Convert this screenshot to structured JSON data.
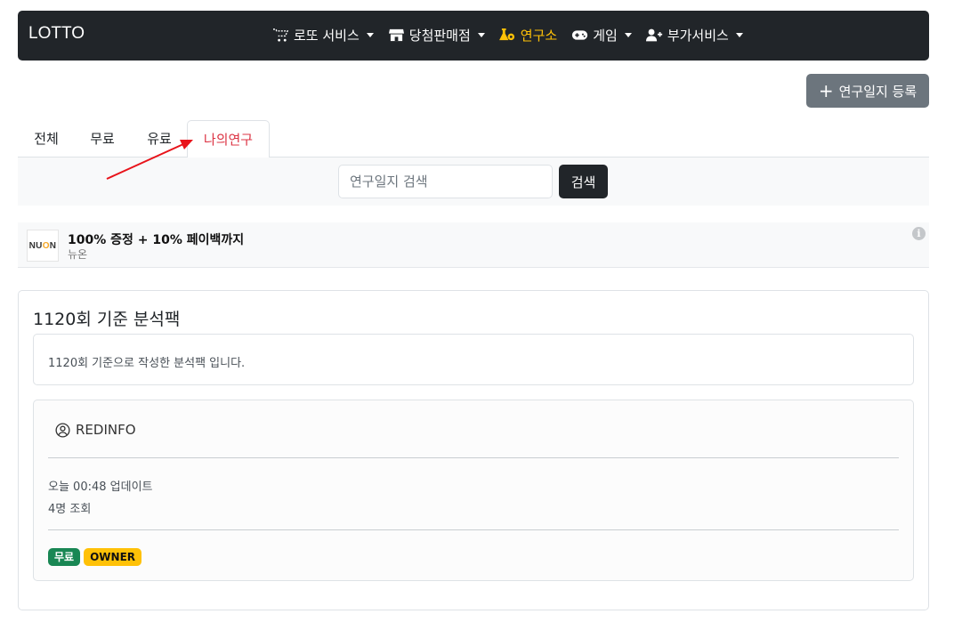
{
  "navbar": {
    "brand": "LOTTO",
    "items": [
      {
        "label": "로또 서비스",
        "icon": "cart-icon",
        "dropdown": true
      },
      {
        "label": "당첨판매점",
        "icon": "store-icon",
        "dropdown": true
      },
      {
        "label": "연구소",
        "icon": "flask-icon",
        "dropdown": false,
        "active": true
      },
      {
        "label": "게임",
        "icon": "gamepad-icon",
        "dropdown": true
      },
      {
        "label": "부가서비스",
        "icon": "user-plus-icon",
        "dropdown": true
      }
    ],
    "active_color": "#ffc107"
  },
  "actions": {
    "register_label": "연구일지 등록"
  },
  "tabs": [
    {
      "label": "전체"
    },
    {
      "label": "무료"
    },
    {
      "label": "유료"
    },
    {
      "label": "나의연구",
      "active": true
    }
  ],
  "search": {
    "placeholder": "연구일지 검색",
    "value": "",
    "button_label": "검색"
  },
  "ad": {
    "logo_text": "NUON",
    "title": "100% 증정 + 10% 페이백까지",
    "subtitle": "뉴온",
    "info_symbol": "i"
  },
  "post": {
    "title": "1120회 기준 분석팩",
    "description": "1120회 기준으로 작성한 분석팩 입니다.",
    "author": "REDINFO",
    "updated": "오늘 00:48 업데이트",
    "views": "4명 조회",
    "badges": {
      "free": "무료",
      "owner": "OWNER"
    }
  },
  "colors": {
    "navbar_bg": "#212529",
    "active_tab": "#dc3545",
    "badge_free": "#198754",
    "badge_owner": "#ffc107",
    "annotation_arrow": "#e8131a"
  }
}
